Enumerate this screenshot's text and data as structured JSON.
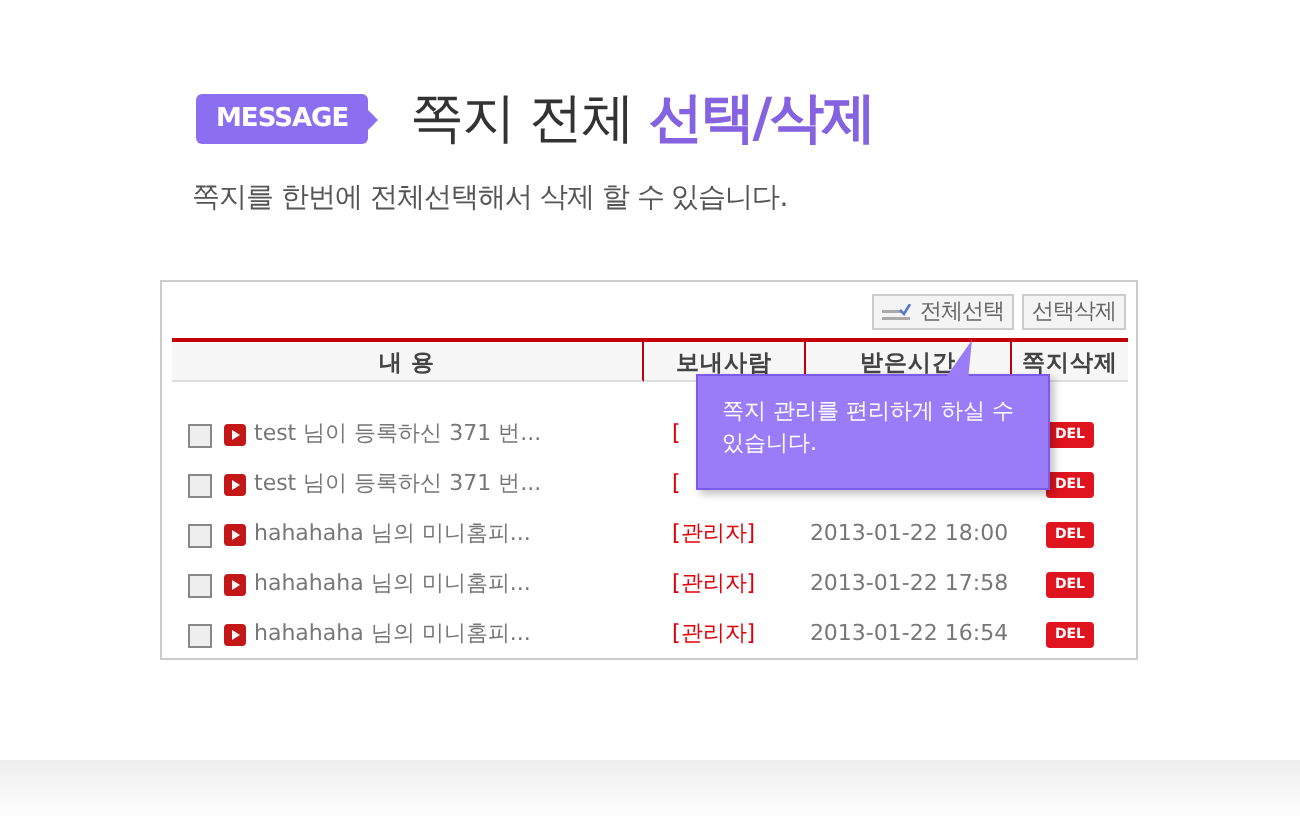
{
  "header": {
    "badge": "MESSAGE",
    "title_plain": "쪽지 전체",
    "title_accent": "선택/삭제",
    "subtitle": "쪽지를 한번에 전체선택해서 삭제 할 수 있습니다."
  },
  "toolbar": {
    "buttons": [
      {
        "label": "전체선택",
        "kind": "icon"
      },
      {
        "label": "선택삭제",
        "kind": "plain"
      }
    ]
  },
  "table": {
    "columns": [
      "내 용",
      "보내사람",
      "받은시간",
      "쪽지삭제"
    ],
    "rows": [
      {
        "checked": false,
        "subject": "test 님이 등록하신 371 번...",
        "sender": "[",
        "delete": "DEL"
      },
      {
        "checked": false,
        "subject": "test 님이 등록하신 371 번...",
        "sender": "[",
        "delete": "DEL"
      },
      {
        "checked": false,
        "subject": "hahahaha 님의 미니홈피...",
        "sender": "[관리자]",
        "time": "2013-01-22 18:00",
        "delete": "DEL"
      },
      {
        "checked": false,
        "subject": "hahahaha 님의 미니홈피...",
        "sender": "[관리자]",
        "time": "2013-01-22 17:58",
        "delete": "DEL"
      },
      {
        "checked": false,
        "subject": "hahahaha 님의 미니홈피...",
        "sender": "[관리자]",
        "time": "2013-01-22 16:54",
        "delete": "DEL"
      }
    ]
  },
  "tooltip": {
    "text": "쪽지 관리를 편리하게 하실 수 있습니다."
  }
}
